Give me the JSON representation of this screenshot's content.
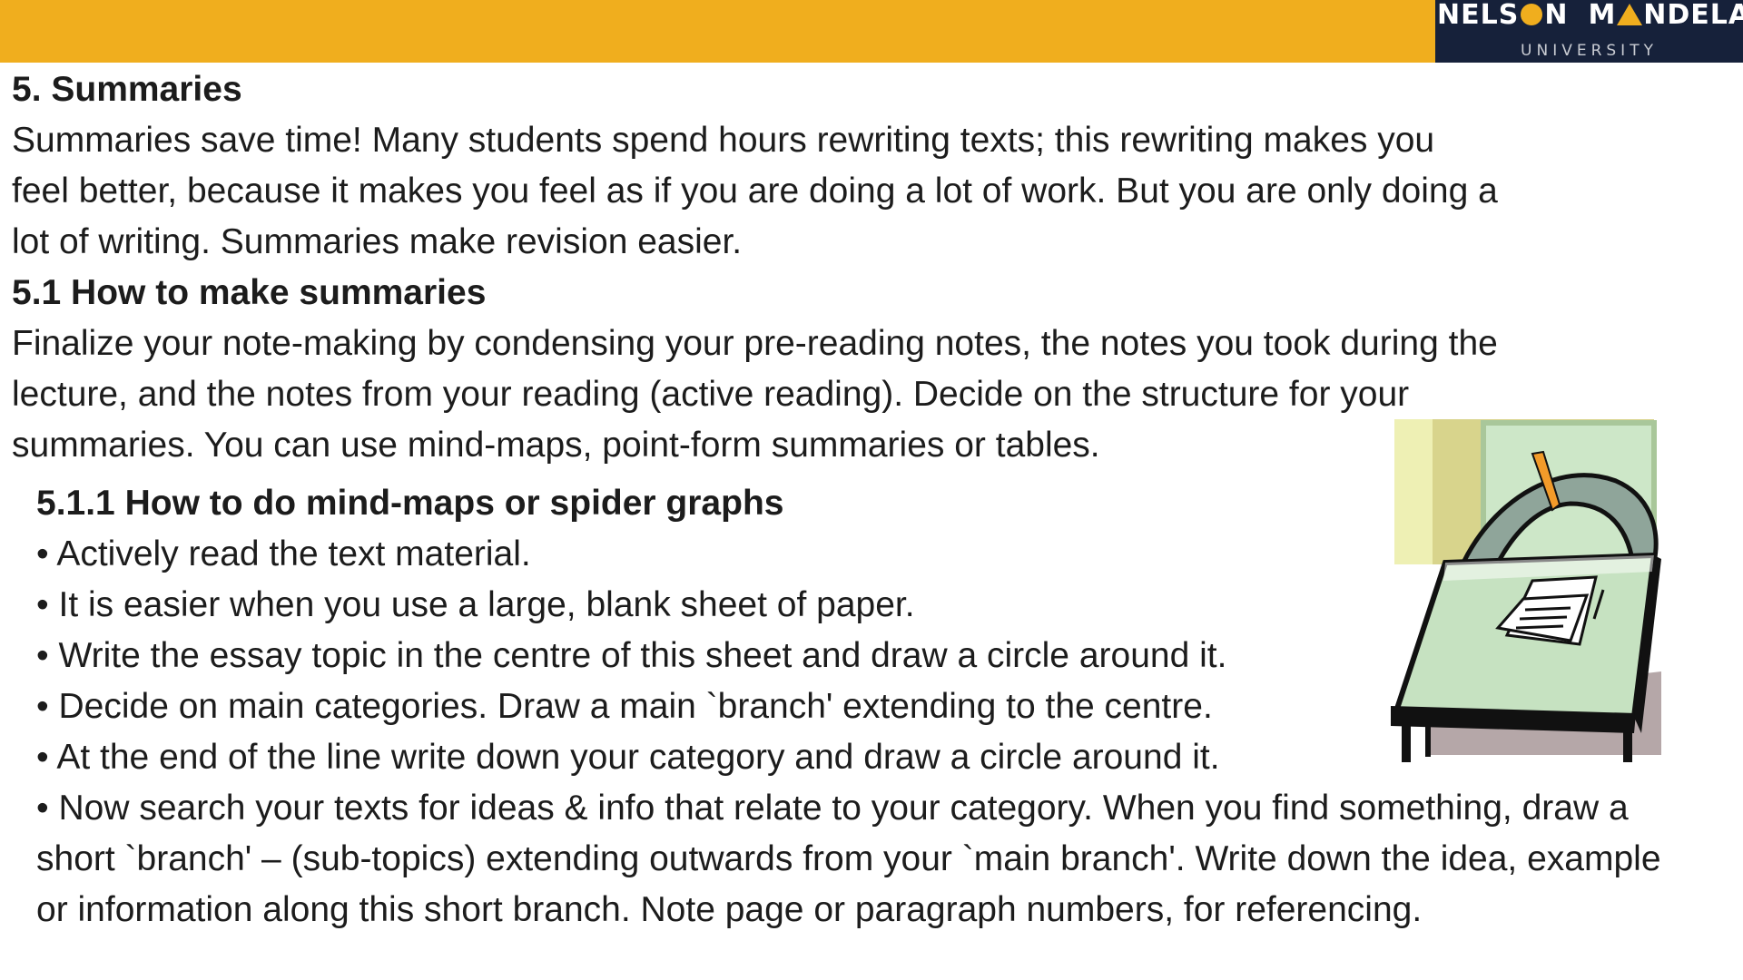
{
  "header": {
    "accent_color": "#f0ae1e",
    "logo_bg_color": "#16213a",
    "logo_text_part1": "NELS",
    "logo_text_part2": "N",
    "logo_text_part3": "M",
    "logo_text_part4": "NDELA",
    "logo_subtitle": "UNIVERSITY"
  },
  "section": {
    "title": "5. Summaries",
    "lines": [
      "Summaries save time! Many students spend hours rewriting texts; this rewriting  makes you",
      "feel better, because it makes you feel as if you are doing a lot of work. But you are only doing a",
      "lot of writing. Summaries make revision easier."
    ]
  },
  "subsection": {
    "title": "5.1 How to make summaries",
    "lines": [
      "Finalize your note-making by condensing your pre-reading notes, the notes you took during the",
      "lecture, and the notes from your reading (active reading). Decide on the structure for your",
      "summaries. You can use mind-maps, point-form summaries or tables."
    ]
  },
  "subsubsection": {
    "title": "5.1.1 How to do mind-maps or spider graphs",
    "bullets": [
      "• Actively read the text material.",
      "• It is easier when you use a large, blank sheet of paper.",
      "• Write the essay topic in the centre of this sheet and draw a circle around it.",
      "• Decide on main categories. Draw a main `branch' extending to the centre.",
      "• At the end of the line write down your category and draw a circle around it.",
      "• Now search your texts for ideas & info that relate to your category. When you find something, draw a",
      "short `branch' – (sub-topics) extending outwards from your `main branch'. Write down the idea, example",
      "or information along this short branch.  Note page or paragraph numbers, for referencing."
    ]
  },
  "illustration": {
    "icon": "person-writing-at-desk-clipart"
  }
}
